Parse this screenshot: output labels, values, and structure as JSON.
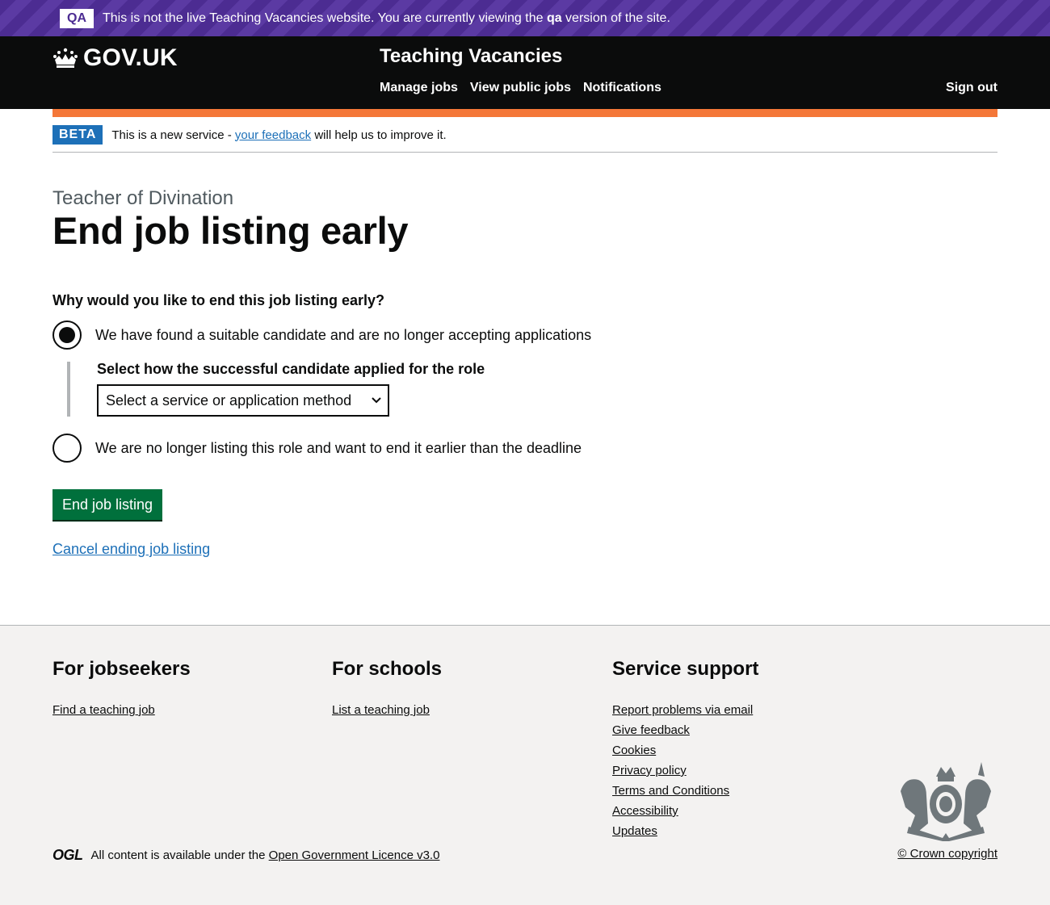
{
  "qa_banner": {
    "tag": "QA",
    "text_before": "This is not the live Teaching Vacancies website. You are currently viewing the ",
    "text_bold": "qa",
    "text_after": " version of the site."
  },
  "header": {
    "logo_text": "GOV.UK",
    "service_name": "Teaching Vacancies",
    "nav": [
      "Manage jobs",
      "View public jobs",
      "Notifications"
    ],
    "sign_out": "Sign out"
  },
  "phase_banner": {
    "tag": "BETA",
    "text_before": "This is a new service - ",
    "link": "your feedback",
    "text_after": " will help us to improve it."
  },
  "main": {
    "caption": "Teacher of Divination",
    "title": "End job listing early",
    "question": "Why would you like to end this job listing early?",
    "options": [
      {
        "label": "We have found a suitable candidate and are no longer accepting applications",
        "checked": true
      },
      {
        "label": "We are no longer listing this role and want to end it earlier than the deadline",
        "checked": false
      }
    ],
    "conditional_label": "Select how the successful candidate applied for the role",
    "select_value": "Select a service or application method",
    "submit": "End job listing",
    "cancel": "Cancel ending job listing"
  },
  "footer": {
    "jobseekers": {
      "title": "For jobseekers",
      "links": [
        "Find a teaching job"
      ]
    },
    "schools": {
      "title": "For schools",
      "links": [
        "List a teaching job"
      ]
    },
    "support": {
      "title": "Service support",
      "links": [
        "Report problems via email",
        "Give feedback",
        "Cookies",
        "Privacy policy",
        "Terms and Conditions",
        "Accessibility",
        "Updates"
      ]
    },
    "ogl": "OGL",
    "licence_text": "All content is available under the ",
    "licence_link": "Open Government Licence v3.0",
    "copyright": "© Crown copyright"
  },
  "colors": {
    "qa_purple": "#4c2c92",
    "header_black": "#0b0c0c",
    "accent_orange": "#f47738",
    "link_blue": "#1d70b8",
    "button_green": "#00703c",
    "footer_grey": "#f3f2f1"
  }
}
